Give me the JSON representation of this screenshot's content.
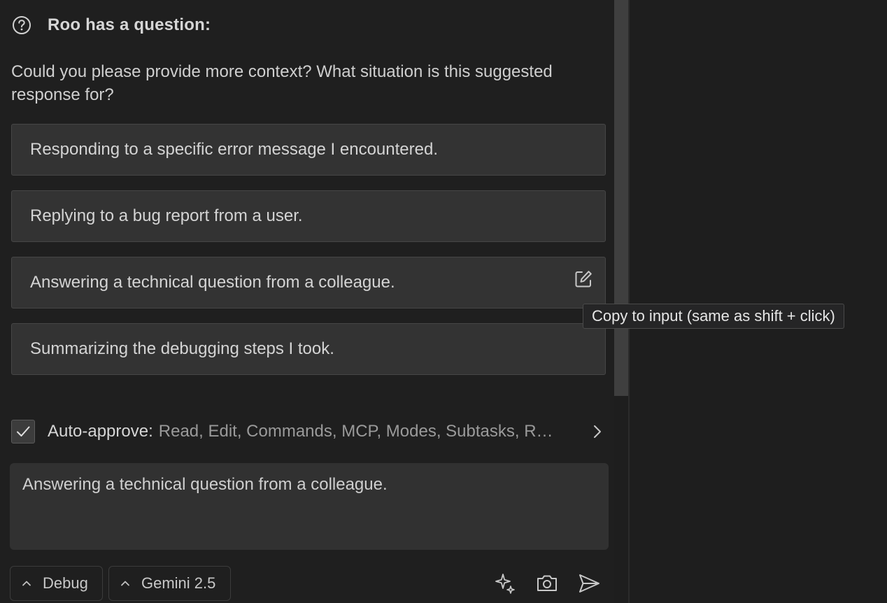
{
  "header": {
    "icon": "question-circle-icon",
    "title": "Roo has a question:"
  },
  "question": {
    "text": "Could you please provide more context? What situation is this suggested response for?"
  },
  "suggestions": [
    {
      "label": "Responding to a specific error message I encountered."
    },
    {
      "label": "Replying to a bug report from a user."
    },
    {
      "label": "Answering a technical question from a colleague."
    },
    {
      "label": "Summarizing the debugging steps I took."
    }
  ],
  "tooltip": {
    "text": "Copy to input (same as shift + click)"
  },
  "auto_approve": {
    "checked": true,
    "label": "Auto-approve:",
    "value": "Read, Edit, Commands, MCP, Modes, Subtasks, Retry, Finish"
  },
  "input": {
    "value": "Answering a technical question from a colleague."
  },
  "footer": {
    "mode_label": "Debug",
    "model_label": "Gemini 2.5",
    "icons": [
      "sparkle-icon",
      "camera-icon",
      "send-icon"
    ]
  },
  "colors": {
    "background": "#1f1f1f",
    "suggestion_bg": "#333333",
    "input_bg": "#313131",
    "text": "#cccccc",
    "muted_text": "#9a9a9a"
  }
}
